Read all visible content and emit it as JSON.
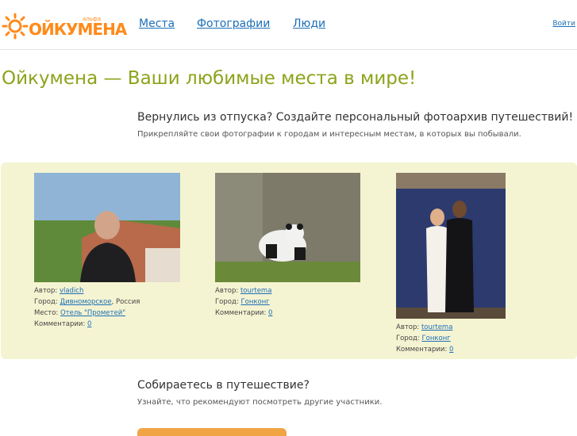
{
  "header": {
    "logo_small": "альфа",
    "logo_text": "ОЙКУМЕНА",
    "nav": [
      "Места",
      "Фотографии",
      "Люди"
    ],
    "login": "Войти"
  },
  "hero": {
    "title": "Ойкумена — Ваши любимые места в мире!"
  },
  "promo": {
    "title": "Вернулись из отпуска? Создайте персональный фотоархив путешествий!",
    "subtitle": "Прикрепляйте свои фотографии к городам и интересным местам, в которых вы побывали."
  },
  "photos": [
    {
      "author_label": "Автор:",
      "author": "vladich",
      "city_label": "Город:",
      "city": "Дивноморское",
      "country": ", Россия",
      "place_label": "Место:",
      "place": "Отель \"Прометей\"",
      "comments_label": "Комментарии:",
      "comments": "0"
    },
    {
      "author_label": "Автор:",
      "author": "tourtema",
      "city_label": "Город:",
      "city": "Гонконг",
      "comments_label": "Комментарии:",
      "comments": "0"
    },
    {
      "author_label": "Автор:",
      "author": "tourtema",
      "city_label": "Город:",
      "city": "Гонконг",
      "comments_label": "Комментарии:",
      "comments": "0"
    }
  ],
  "plan": {
    "title": "Собираетесь в путешествие?",
    "subtitle": "Узнайте, что рекомендуют посмотреть другие участники."
  },
  "colors": {
    "accent_green": "#8ba41b",
    "link_blue": "#1d6fb8",
    "logo_orange": "#ff8a1a",
    "panel_bg": "#f5f4d2"
  }
}
